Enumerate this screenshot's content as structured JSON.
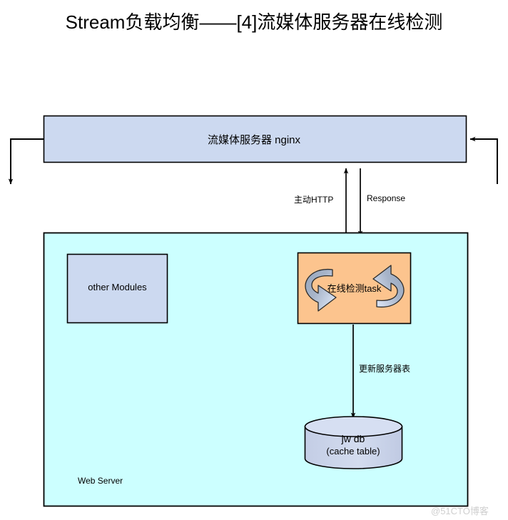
{
  "title": "Stream负载均衡——[4]流媒体服务器在线检测",
  "nodes": {
    "nginx": {
      "label": "流媒体服务器 nginx",
      "fill": "#ccd9f0",
      "stroke": "#000000"
    },
    "web_server": {
      "label": "Web Server",
      "fill": "#ccffff",
      "stroke": "#000000"
    },
    "other_modules": {
      "label": "other Modules",
      "fill": "#ccd9f0",
      "stroke": "#000000"
    },
    "task": {
      "label": "在线检测task",
      "fill": "#fcc48e",
      "stroke": "#000000"
    },
    "database": {
      "label_line1": "jw db",
      "label_line2": "(cache table)",
      "fill": "#ccd5eb",
      "stroke": "#000000"
    }
  },
  "edges": {
    "http": {
      "label": "主动HTTP",
      "direction": "up"
    },
    "response": {
      "label": "Response",
      "direction": "down"
    },
    "update_table": {
      "label": "更新服务器表",
      "direction": "down"
    },
    "left_out": {
      "label": "",
      "direction": "down"
    },
    "right_in": {
      "label": "",
      "direction": "left"
    }
  },
  "icons": {
    "cycle": "refresh-cycle-icon",
    "cylinder": "database-cylinder-icon"
  },
  "watermark": "@51CTO博客"
}
